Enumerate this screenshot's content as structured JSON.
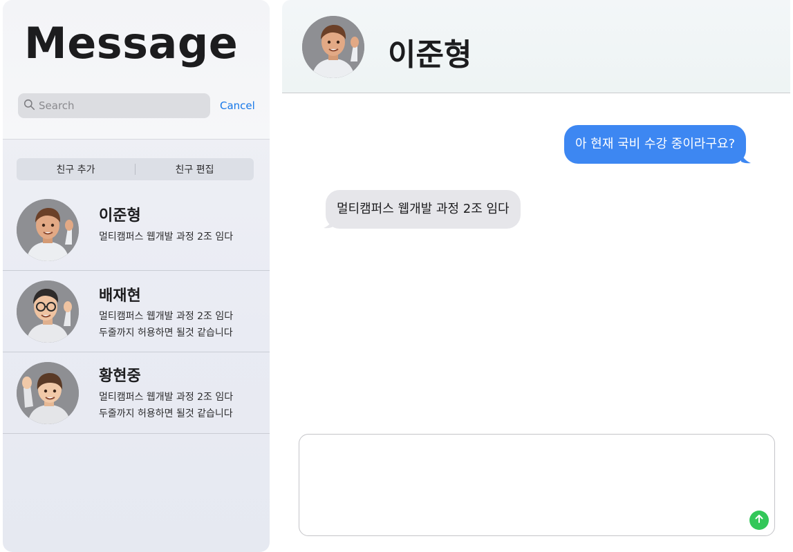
{
  "sidebar": {
    "title": "Message",
    "search": {
      "placeholder": "Search",
      "value": ""
    },
    "cancel_label": "Cancel",
    "segment": {
      "add_label": "친구 추가",
      "edit_label": "친구 편집"
    },
    "contacts": [
      {
        "name": "이준형",
        "lines": [
          "멀티캠퍼스 웹개발 과정 2조 임다"
        ]
      },
      {
        "name": "배재현",
        "lines": [
          "멀티캠퍼스 웹개발 과정 2조 임다",
          "두줄까지 허용하면 될것 같습니다"
        ]
      },
      {
        "name": "황현중",
        "lines": [
          "멀티캠퍼스 웹개발 과정 2조 임다",
          "두줄까지 허용하면 될것 같습니다"
        ]
      }
    ]
  },
  "chat": {
    "title": "이준형",
    "messages": [
      {
        "direction": "outgoing",
        "text": "아 현재 국비 수강 중이라구요?"
      },
      {
        "direction": "incoming",
        "text": "멀티캠퍼스 웹개발 과정 2조 임다"
      }
    ],
    "composer": {
      "value": ""
    }
  },
  "colors": {
    "accent": "#1677e8",
    "outgoing_bubble": "#3d87f2",
    "incoming_bubble": "#e6e6ea",
    "send_button": "#33c759"
  },
  "icons": {
    "search": "magnifier-icon",
    "send": "arrow-up-icon"
  }
}
